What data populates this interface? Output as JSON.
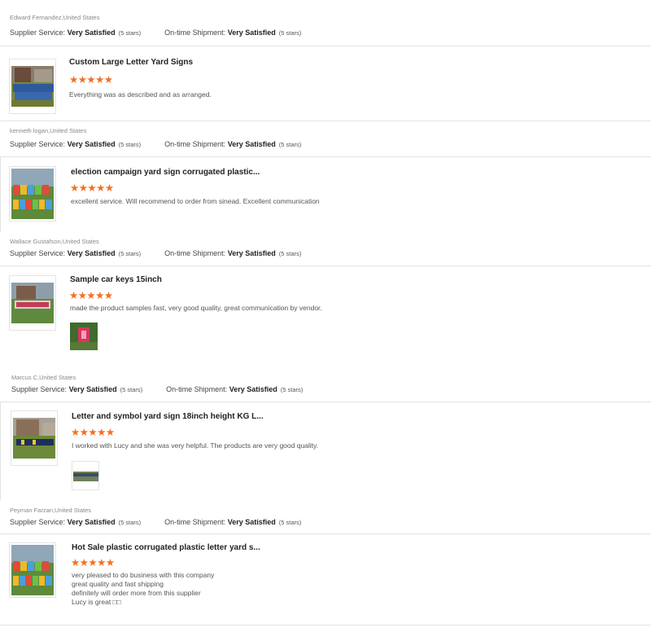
{
  "labels": {
    "supplier_service": "Supplier Service:",
    "ontime_shipment": "On-time Shipment:"
  },
  "reviews": [
    {
      "reviewer": "Edward Fernandez,United States",
      "supplier_value": "Very Satisfied",
      "supplier_stars": "(5 stars)",
      "shipment_value": "Very Satisfied",
      "shipment_stars": "(5 stars)",
      "product_title": "Custom Large Letter Yard Signs",
      "rating_stars": "★★★★★",
      "rating": 5,
      "comment": [
        "Everything was as described and as arranged."
      ]
    },
    {
      "reviewer": "kenneth logan,United States",
      "supplier_value": "Very Satisfied",
      "supplier_stars": "(5 stars)",
      "shipment_value": "Very Satisfied",
      "shipment_stars": "(5 stars)",
      "product_title": "election campaign yard sign corrugated plastic...",
      "rating_stars": "★★★★★",
      "rating": 5,
      "comment": [
        "excellent service. Will recommend to order from sinead. Excellent communication"
      ]
    },
    {
      "reviewer": "Wallace Gustafson,United States",
      "supplier_value": "Very Satisfied",
      "supplier_stars": "(5 stars)",
      "shipment_value": "Very Satisfied",
      "shipment_stars": "(5 stars)",
      "product_title": "Sample car keys 15inch",
      "rating_stars": "★★★★★",
      "rating": 5,
      "comment": [
        "made the product samples fast, very good quality, great communication by vendor."
      ]
    },
    {
      "reviewer": "Marcus C,United States",
      "supplier_value": "Very Satisfied",
      "supplier_stars": "(5 stars)",
      "shipment_value": "Very Satisfied",
      "shipment_stars": "(5 stars)",
      "product_title": "Letter and symbol yard sign 18inch height KG L...",
      "rating_stars": "★★★★★",
      "rating": 5,
      "comment": [
        "I worked with Lucy and she was very helpful. The products are very good quality."
      ]
    },
    {
      "reviewer": "Peyman Farzan,United States",
      "supplier_value": "Very Satisfied",
      "supplier_stars": "(5 stars)",
      "shipment_value": "Very Satisfied",
      "shipment_stars": "(5 stars)",
      "product_title": "Hot Sale plastic corrugated plastic letter yard s...",
      "rating_stars": "★★★★★",
      "rating": 5,
      "comment": [
        "very pleased to do business with this company",
        "great quality and fast shipping",
        "definitely will order more from this supplier",
        "Lucy is great □□"
      ]
    }
  ],
  "colors": {
    "star": "#f36f21",
    "border": "#e3e3e3"
  }
}
